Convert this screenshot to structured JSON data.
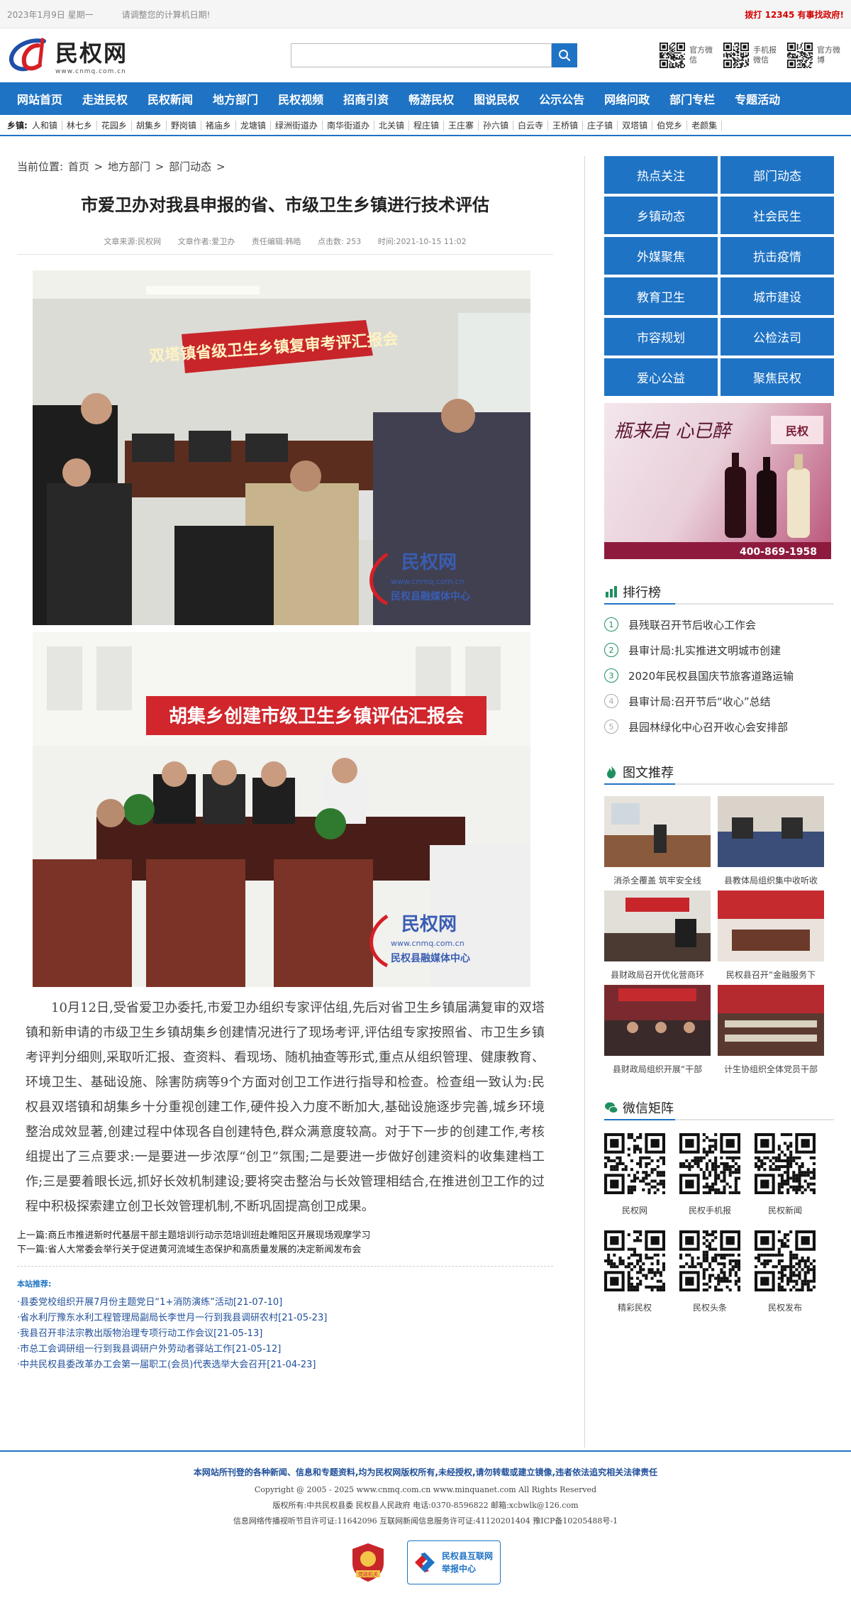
{
  "topbar": {
    "date": "2023年1月9日 星期一",
    "hint": "请调整您的计算机日期!",
    "hotline": "拨打 12345 有事找政府!"
  },
  "header": {
    "logo_text": "民权网",
    "logo_url": "www.cnmq.com.cn",
    "search_placeholder": "",
    "qr_labels": [
      "官方微信",
      "手机报微信",
      "官方微博"
    ]
  },
  "nav": [
    "网站首页",
    "走进民权",
    "民权新闻",
    "地方部门",
    "民权视频",
    "招商引资",
    "畅游民权",
    "图说民权",
    "公示公告",
    "网络问政",
    "部门专栏",
    "专题活动"
  ],
  "towns": {
    "label": "乡镇:",
    "items": [
      "人和镇",
      "林七乡",
      "花园乡",
      "胡集乡",
      "野岗镇",
      "褚庙乡",
      "龙塘镇",
      "绿洲街道办",
      "南华街道办",
      "北关镇",
      "程庄镇",
      "王庄寨",
      "孙六镇",
      "白云寺",
      "王桥镇",
      "庄子镇",
      "双塔镇",
      "伯党乡",
      "老颜集"
    ]
  },
  "breadcrumb": {
    "label": "当前位置:",
    "items": [
      "首页",
      ">",
      "地方部门",
      ">",
      "部门动态",
      ">"
    ]
  },
  "article": {
    "title": "市爱卫办对我县申报的省、市级卫生乡镇进行技术评估",
    "meta": {
      "source": "文章来源:民权网",
      "author": "文章作者:爱卫办",
      "editor": "责任编辑:韩皓",
      "clicks": "点击数: 253",
      "time": "时间:2021-10-15 11:02"
    },
    "photo1_banner": "双塔镇省级卫生乡镇复审考评汇报会",
    "photo2_banner": "胡集乡创建市级卫生乡镇评估汇报会",
    "watermark": "民权网",
    "watermark_url": "www.cnmq.com.cn",
    "watermark_sub": "民权县融媒体中心",
    "body": "10月12日,受省爱卫办委托,市爱卫办组织专家评估组,先后对省卫生乡镇届满复审的双塔镇和新申请的市级卫生乡镇胡集乡创建情况进行了现场考评,评估组专家按照省、市卫生乡镇考评判分细则,采取听汇报、查资料、看现场、随机抽查等形式,重点从组织管理、健康教育、环境卫生、基础设施、除害防病等9个方面对创卫工作进行指导和检查。检查组一致认为:民权县双塔镇和胡集乡十分重视创建工作,硬件投入力度不断加大,基础设施逐步完善,城乡环境整治成效显著,创建过程中体现各自创建特色,群众满意度较高。对于下一步的创建工作,考核组提出了三点要求:一是要进一步浓厚“创卫”氛围;二是要进一步做好创建资料的收集建档工作;三是要着眼长远,抓好长效机制建设;要将突击整治与长效管理相结合,在推进创卫工作的过程中积极探索建立创卫长效管理机制,不断巩固提高创卫成果。",
    "prev": "上一篇:商丘市推进新时代基层干部主题培训行动示范培训班赴睢阳区开展现场观摩学习",
    "next": "下一篇:省人大常委会举行关于促进黄河流域生态保护和高质量发展的决定新闻发布会"
  },
  "recommend": {
    "title": "本站推荐:",
    "items": [
      "·县委党校组织开展7月份主题党日“1+消防演练”活动[21-07-10]",
      "·省水利厅豫东水利工程管理局副局长李世月一行到我县调研农村[21-05-23]",
      "·我县召开非法宗教出版物治理专项行动工作会议[21-05-13]",
      "·市总工会调研组一行到我县调研户外劳动者驿站工作[21-05-12]",
      "·中共民权县委改革办工会第一届职工(会员)代表选举大会召开[21-04-23]"
    ]
  },
  "side": {
    "grid": [
      "热点关注",
      "部门动态",
      "乡镇动态",
      "社会民生",
      "外媒聚焦",
      "抗击疫情",
      "教育卫生",
      "城市建设",
      "市容规划",
      "公检法司",
      "爱心公益",
      "聚焦民权"
    ],
    "ad": {
      "slogan": "瓶来启 心已醉",
      "brand": "民权",
      "phone": "400-869-1958"
    },
    "rank_title": "排行榜",
    "rank": [
      {
        "num": "1",
        "text": "县残联召开节后收心工作会"
      },
      {
        "num": "2",
        "text": "县审计局:扎实推进文明城市创建"
      },
      {
        "num": "3",
        "text": "2020年民权县国庆节旅客道路运输"
      },
      {
        "num": "4",
        "text": "县审计局:召开节后“收心”总结"
      },
      {
        "num": "5",
        "text": "县园林绿化中心召开收心会安排部"
      }
    ],
    "pics_title": "图文推荐",
    "pics": [
      "消杀全覆盖 筑牢安全线",
      "县教体局组织集中收听收",
      "县财政局召开优化营商环",
      "民权县召开“金融服务下",
      "县财政局组织开展“干部",
      "计生协组织全体党员干部"
    ],
    "wechat_title": "微信矩阵",
    "wechat": [
      "民权网",
      "民权手机报",
      "民权新闻",
      "精彩民权",
      "民权头条",
      "民权发布"
    ]
  },
  "footer": {
    "notice": "本网站所刊登的各种新闻、信息和专题资料,均为民权网版权所有,未经授权,请勿转载或建立镜像,违者依法追究相关法律责任",
    "copyright": "Copyright @ 2005 - 2025 www.cnmq.com.cn www.minquanet.com All Rights Reserved",
    "owner": "版权所有:中共民权县委 民权县人民政府 电话:0370-8596822 邮箱:xcbwlk@126.com",
    "license": "信息网络传播视听节目许可证:11642096 互联网新闻信息服务许可证:41120201404 豫ICP备10205488号-1",
    "badge_a": "党政机关",
    "badge_b_line1": "民权县互联网",
    "badge_b_line2": "举报中心"
  }
}
